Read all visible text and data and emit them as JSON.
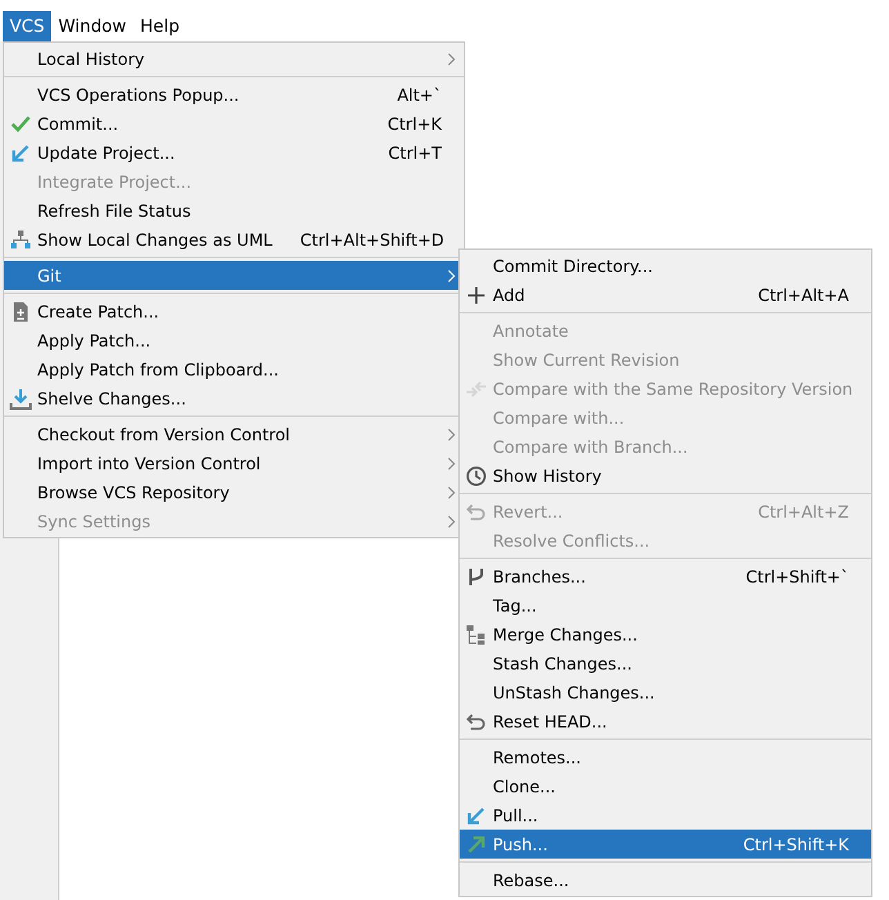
{
  "menu_bar": [
    {
      "label": "VCS",
      "selected": true
    },
    {
      "label": "Window",
      "selected": false
    },
    {
      "label": "Help",
      "selected": false
    }
  ],
  "vcs_menu": [
    {
      "kind": "item",
      "label": "Local History",
      "submenu": true,
      "disabled": false,
      "selected": false
    },
    {
      "kind": "separator"
    },
    {
      "kind": "item",
      "label": "VCS Operations Popup...",
      "shortcut": "Alt+`",
      "disabled": false,
      "selected": false
    },
    {
      "kind": "item",
      "label": "Commit...",
      "shortcut": "Ctrl+K",
      "disabled": false,
      "selected": false
    },
    {
      "kind": "item",
      "label": "Update Project...",
      "shortcut": "Ctrl+T",
      "disabled": false,
      "selected": false
    },
    {
      "kind": "item",
      "label": "Integrate Project...",
      "disabled": true,
      "selected": false
    },
    {
      "kind": "item",
      "label": "Refresh File Status",
      "disabled": false,
      "selected": false
    },
    {
      "kind": "item",
      "label": "Show Local Changes as UML",
      "shortcut": "Ctrl+Alt+Shift+D",
      "disabled": false,
      "selected": false
    },
    {
      "kind": "separator"
    },
    {
      "kind": "item",
      "label": "Git",
      "submenu": true,
      "disabled": false,
      "selected": true
    },
    {
      "kind": "separator"
    },
    {
      "kind": "item",
      "label": "Create Patch...",
      "disabled": false,
      "selected": false
    },
    {
      "kind": "item",
      "label": "Apply Patch...",
      "disabled": false,
      "selected": false
    },
    {
      "kind": "item",
      "label": "Apply Patch from Clipboard...",
      "disabled": false,
      "selected": false
    },
    {
      "kind": "item",
      "label": "Shelve Changes...",
      "disabled": false,
      "selected": false
    },
    {
      "kind": "separator"
    },
    {
      "kind": "item",
      "label": "Checkout from Version Control",
      "submenu": true,
      "disabled": false,
      "selected": false
    },
    {
      "kind": "item",
      "label": "Import into Version Control",
      "submenu": true,
      "disabled": false,
      "selected": false
    },
    {
      "kind": "item",
      "label": "Browse VCS Repository",
      "submenu": true,
      "disabled": false,
      "selected": false
    },
    {
      "kind": "item",
      "label": "Sync Settings",
      "submenu": true,
      "disabled": true,
      "selected": false
    }
  ],
  "git_menu": [
    {
      "kind": "item",
      "label": "Commit Directory...",
      "disabled": false,
      "selected": false
    },
    {
      "kind": "item",
      "label": "Add",
      "shortcut": "Ctrl+Alt+A",
      "disabled": false,
      "selected": false
    },
    {
      "kind": "separator"
    },
    {
      "kind": "item",
      "label": "Annotate",
      "disabled": true,
      "selected": false
    },
    {
      "kind": "item",
      "label": "Show Current Revision",
      "disabled": true,
      "selected": false
    },
    {
      "kind": "item",
      "label": "Compare with the Same Repository Version",
      "disabled": true,
      "selected": false
    },
    {
      "kind": "item",
      "label": "Compare with...",
      "disabled": true,
      "selected": false
    },
    {
      "kind": "item",
      "label": "Compare with Branch...",
      "disabled": true,
      "selected": false
    },
    {
      "kind": "item",
      "label": "Show History",
      "disabled": false,
      "selected": false
    },
    {
      "kind": "separator"
    },
    {
      "kind": "item",
      "label": "Revert...",
      "shortcut": "Ctrl+Alt+Z",
      "disabled": true,
      "selected": false
    },
    {
      "kind": "item",
      "label": "Resolve Conflicts...",
      "disabled": true,
      "selected": false
    },
    {
      "kind": "separator"
    },
    {
      "kind": "item",
      "label": "Branches...",
      "shortcut": "Ctrl+Shift+`",
      "disabled": false,
      "selected": false
    },
    {
      "kind": "item",
      "label": "Tag...",
      "disabled": false,
      "selected": false
    },
    {
      "kind": "item",
      "label": "Merge Changes...",
      "disabled": false,
      "selected": false
    },
    {
      "kind": "item",
      "label": "Stash Changes...",
      "disabled": false,
      "selected": false
    },
    {
      "kind": "item",
      "label": "UnStash Changes...",
      "disabled": false,
      "selected": false
    },
    {
      "kind": "item",
      "label": "Reset HEAD...",
      "disabled": false,
      "selected": false
    },
    {
      "kind": "separator"
    },
    {
      "kind": "item",
      "label": "Remotes...",
      "disabled": false,
      "selected": false
    },
    {
      "kind": "item",
      "label": "Clone...",
      "disabled": false,
      "selected": false
    },
    {
      "kind": "item",
      "label": "Pull...",
      "disabled": false,
      "selected": false
    },
    {
      "kind": "item",
      "label": "Push...",
      "shortcut": "Ctrl+Shift+K",
      "disabled": false,
      "selected": true
    },
    {
      "kind": "separator"
    },
    {
      "kind": "item",
      "label": "Rebase...",
      "disabled": false,
      "selected": false
    }
  ]
}
